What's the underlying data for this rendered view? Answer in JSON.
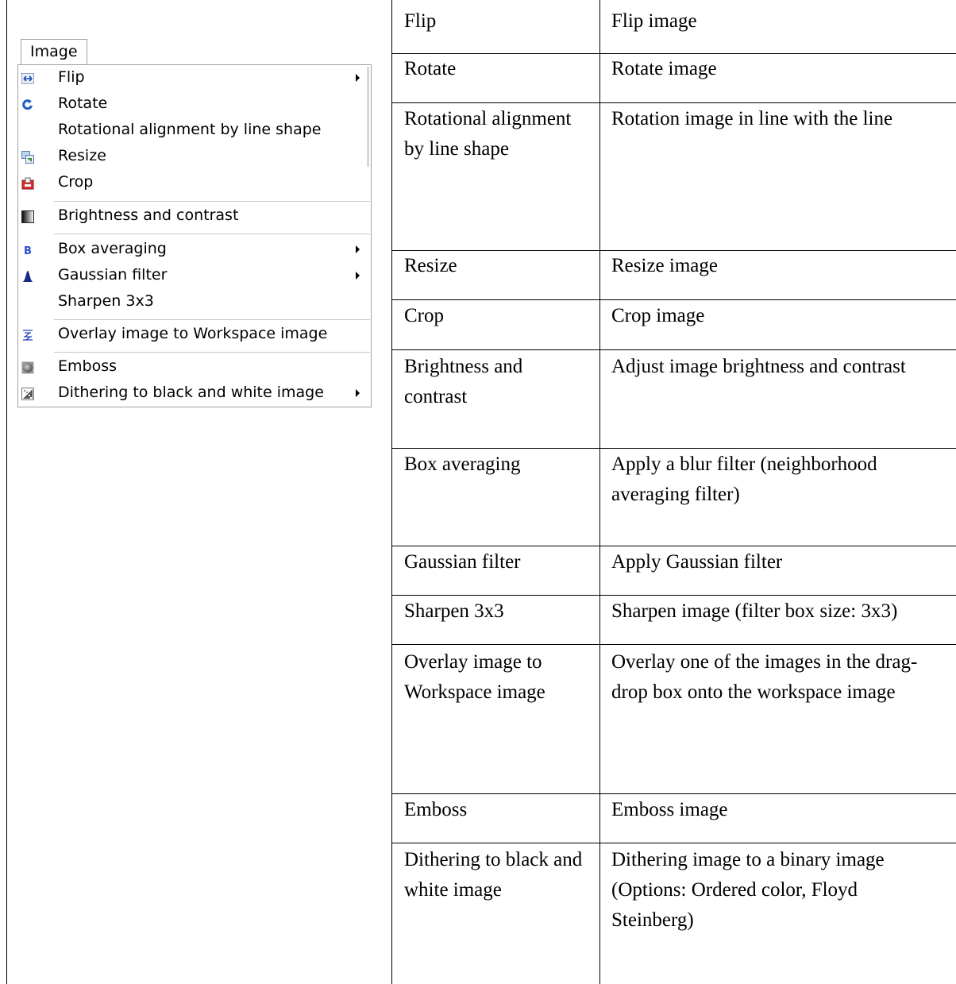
{
  "menu": {
    "tab_label": "Image",
    "items": [
      {
        "label": "Flip",
        "icon": "flip-icon",
        "submenu": true
      },
      {
        "label": "Rotate",
        "icon": "rotate-icon",
        "submenu": false
      },
      {
        "label": "Rotational alignment by line shape",
        "icon": "",
        "submenu": false
      },
      {
        "label": "Resize",
        "icon": "resize-icon",
        "submenu": false
      },
      {
        "label": "Crop",
        "icon": "crop-icon",
        "submenu": false
      },
      {
        "label": "Brightness and contrast",
        "icon": "brightness-icon",
        "submenu": false
      },
      {
        "label": "Box averaging",
        "icon": "box-averaging-icon",
        "submenu": true
      },
      {
        "label": "Gaussian filter",
        "icon": "gaussian-icon",
        "submenu": true
      },
      {
        "label": "Sharpen 3x3",
        "icon": "",
        "submenu": false
      },
      {
        "label": "Overlay image to Workspace image",
        "icon": "overlay-icon",
        "submenu": false
      },
      {
        "label": "Emboss",
        "icon": "emboss-icon",
        "submenu": false
      },
      {
        "label": "Dithering to black and white image",
        "icon": "dithering-icon",
        "submenu": true
      }
    ]
  },
  "table": {
    "rows": [
      {
        "name": "Flip",
        "description": "Flip image"
      },
      {
        "name": "Rotate",
        "description": "Rotate image"
      },
      {
        "name": "Rotational alignment by line shape",
        "description": "Rotation image in line with the line"
      },
      {
        "name": "Resize",
        "description": "Resize image"
      },
      {
        "name": "Crop",
        "description": "Crop image"
      },
      {
        "name": "Brightness and contrast",
        "description": "Adjust image brightness and contrast"
      },
      {
        "name": "Box averaging",
        "description": "Apply a blur filter (neighborhood averaging filter)"
      },
      {
        "name": "Gaussian filter",
        "description": "Apply Gaussian filter"
      },
      {
        "name": "Sharpen 3x3",
        "description": "Sharpen image (filter box size: 3x3)"
      },
      {
        "name": "Overlay image to Workspace image",
        "description": "Overlay one of the images in the drag-drop box onto the workspace image"
      },
      {
        "name": "Emboss",
        "description": "Emboss image"
      },
      {
        "name": "Dithering to black and white image",
        "description": "Dithering image to a binary image (Options: Ordered color, Floyd Steinberg)"
      }
    ]
  }
}
